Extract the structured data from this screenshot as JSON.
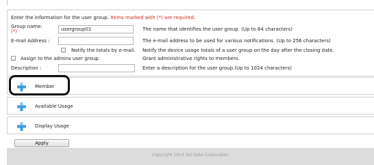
{
  "intro": {
    "text": "Enter the information for the user group. ",
    "required_note": "Items marked with (*) are required."
  },
  "form": {
    "group_name": {
      "label": "Group name:",
      "required_mark": "(*)",
      "value": "usergroup01",
      "description": "The name that identifies the user group. (Up to 64 characters)"
    },
    "email": {
      "label": "E-mail Address :",
      "value": "",
      "description": "The e-mail address to be used for various notifications. (Up to 256 characters)"
    },
    "notify": {
      "label": "Notify the totals by e-mail.",
      "checked": false,
      "description": "Notify the device usage totals of a user group on the day after the closing date."
    },
    "admins": {
      "label": "Assign to the admins user group.",
      "checked": false,
      "description": "Grant administrative rights to members."
    },
    "description_field": {
      "label": "Description :",
      "value": "",
      "description": "Enter a description for the user group.(Up to 1024 characters)"
    }
  },
  "sections": [
    {
      "label": "Member",
      "icon": "plus-icon"
    },
    {
      "label": "Available Usage",
      "icon": "plus-icon"
    },
    {
      "label": "Display Usage",
      "icon": "plus-icon"
    }
  ],
  "apply_label": "Apply",
  "footer": "Copyright 2014 Oki Data Corporation",
  "colors": {
    "required": "#d9241b",
    "plus_icon": "#3d9be0",
    "footer_bg": "#dcdcdc"
  }
}
